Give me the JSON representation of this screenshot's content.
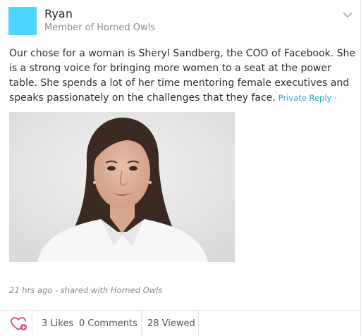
{
  "post": {
    "author_name": "Ryan",
    "author_subtitle": "Member of Horned Owls",
    "body_text": "Our chose for a woman is Sheryl Sandberg, the COO of Facebook.  She is a strong voice for bringing more women to a seat at the power table.  She spends a lot of her time mentoring female executives and speaks passionately on the challenges that they face.",
    "private_reply_label": "Private Reply ·",
    "timestamp": "21 hrs ago - shared with Horned Owls",
    "image_alt": "Portrait photo of a woman in a white collared shirt"
  },
  "footer": {
    "likes": "3 Likes",
    "comments": "0 Comments",
    "viewed": "28 Viewed"
  },
  "colors": {
    "avatar": "#4dd4ff",
    "link": "#2ba7c9",
    "like_icon": "#d9467a"
  },
  "icons": {
    "menu": "chevron-down-icon",
    "like": "heart-plus-icon"
  }
}
